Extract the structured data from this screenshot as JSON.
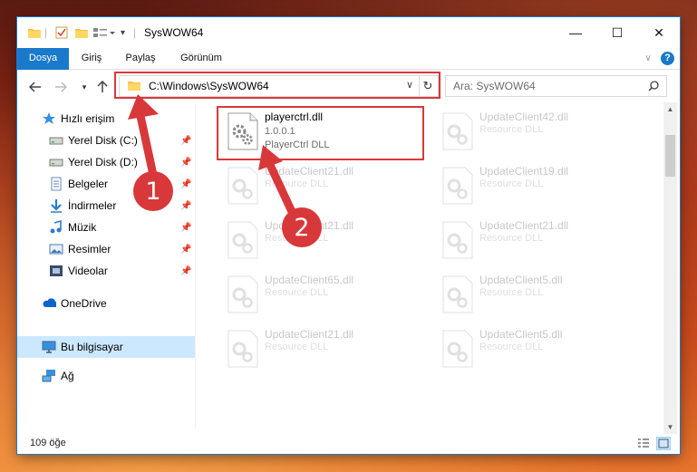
{
  "window": {
    "title": "SysWOW64",
    "controls": {
      "minimize": "—",
      "maximize": "☐",
      "close": "✕"
    }
  },
  "ribbon": {
    "tabs": [
      "Dosya",
      "Giriş",
      "Paylaş",
      "Görünüm"
    ],
    "help": "?"
  },
  "navigation": {
    "address": "C:\\Windows\\SysWOW64",
    "search_placeholder": "Ara: SysWOW64"
  },
  "sidebar": {
    "quick_access": "Hızlı erişim",
    "items": [
      {
        "label": "Yerel Disk (C:)",
        "icon": "drive-icon",
        "pinned": true
      },
      {
        "label": "Yerel Disk (D:)",
        "icon": "drive-icon",
        "pinned": true
      },
      {
        "label": "Belgeler",
        "icon": "documents-icon",
        "pinned": true
      },
      {
        "label": "İndirmeler",
        "icon": "downloads-icon",
        "pinned": true
      },
      {
        "label": "Müzik",
        "icon": "music-icon",
        "pinned": true
      },
      {
        "label": "Resimler",
        "icon": "pictures-icon",
        "pinned": true
      },
      {
        "label": "Videolar",
        "icon": "videos-icon",
        "pinned": true
      }
    ],
    "onedrive": "OneDrive",
    "this_pc": "Bu bilgisayar",
    "network": "Ağ"
  },
  "files": [
    {
      "name": "playerctrl.dll",
      "version": "1.0.0.1",
      "desc": "PlayerCtrl DLL"
    },
    {
      "name": "UpdateClient42.dll",
      "version": "",
      "desc": "Resource DLL"
    },
    {
      "name": "UpdateClient21.dll",
      "version": "",
      "desc": "Resource DLL"
    },
    {
      "name": "UpdateClient19.dll",
      "version": "",
      "desc": "Resource DLL"
    },
    {
      "name": "UpdateClient21.dll",
      "version": "",
      "desc": "Resource DLL"
    },
    {
      "name": "UpdateClient21.dll",
      "version": "",
      "desc": "Resource DLL"
    },
    {
      "name": "UpdateClient65.dll",
      "version": "",
      "desc": "Resource DLL"
    },
    {
      "name": "UpdateClient5.dll",
      "version": "",
      "desc": "Resource DLL"
    },
    {
      "name": "UpdateClient21.dll",
      "version": "",
      "desc": "Resource DLL"
    },
    {
      "name": "UpdateClient5.dll",
      "version": "",
      "desc": "Resource DLL"
    }
  ],
  "status": {
    "count": "109 öğe"
  },
  "annotations": {
    "step1": "1",
    "step2": "2",
    "color": "#d8383a"
  }
}
